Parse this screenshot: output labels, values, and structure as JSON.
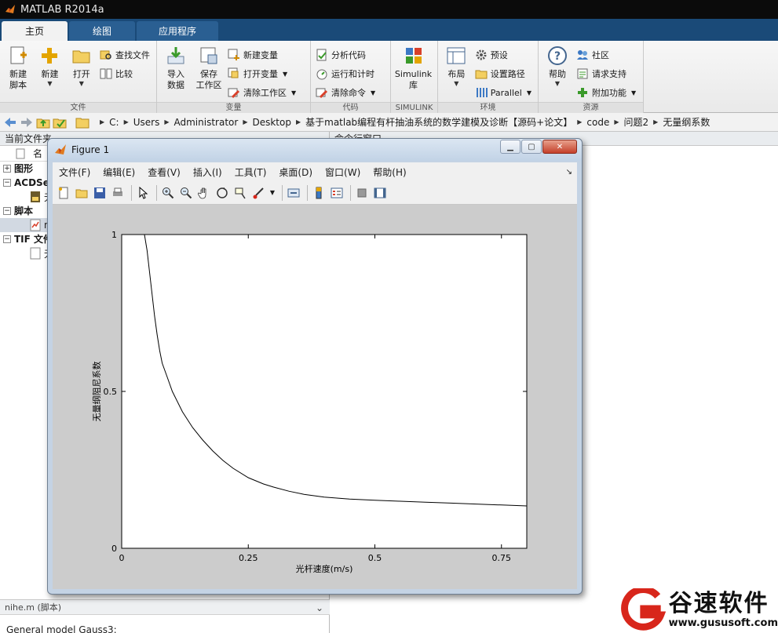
{
  "app": {
    "title": "MATLAB R2014a"
  },
  "tabs": [
    {
      "label": "主页"
    },
    {
      "label": "绘图"
    },
    {
      "label": "应用程序"
    }
  ],
  "ribbon": {
    "file": {
      "label": "文件",
      "new_script": "新建\n脚本",
      "new": "新建",
      "open": "打开",
      "find_files": "查找文件",
      "compare": "比较"
    },
    "variable": {
      "label": "变量",
      "import": "导入\n数据",
      "save_ws": "保存\n工作区",
      "new_var": "新建变量",
      "open_var": "打开变量",
      "clear_ws": "清除工作区"
    },
    "code": {
      "label": "代码",
      "analyze": "分析代码",
      "run_time": "运行和计时",
      "clear_cmd": "清除命令"
    },
    "simulink": {
      "label": "SIMULINK",
      "lib": "Simulink\n库"
    },
    "env": {
      "label": "环境",
      "layout": "布局",
      "prefs": "预设",
      "set_path": "设置路径",
      "parallel": "Parallel"
    },
    "resources": {
      "label": "资源",
      "help": "帮助",
      "community": "社区",
      "support": "请求支持",
      "addons": "附加功能"
    }
  },
  "address": {
    "crumbs": [
      "C:",
      "Users",
      "Administrator",
      "Desktop",
      "基于matlab编程有杆抽油系统的数学建模及诊断【源码+论文】",
      "code",
      "问题2",
      "无量纲系数"
    ]
  },
  "left_panel": {
    "title": "当前文件夹",
    "col_name": "名",
    "groups": [
      {
        "label": "图形",
        "expanded": false
      },
      {
        "label": "ACDSe",
        "expanded": true
      },
      {
        "label": "脚本",
        "expanded": true
      },
      {
        "label": "TIF 文件",
        "expanded": true
      }
    ],
    "leaf_acdsee": "无",
    "leaf_script": "n",
    "leaf_tif": "无",
    "detail_header": "nihe.m (脚本)",
    "detail_text": "General model Gauss3:"
  },
  "right_panel": {
    "title": "命令行窗口"
  },
  "figure": {
    "title": "Figure 1",
    "menus": [
      "文件(F)",
      "编辑(E)",
      "查看(V)",
      "插入(I)",
      "工具(T)",
      "桌面(D)",
      "窗口(W)",
      "帮助(H)"
    ]
  },
  "chart_data": {
    "type": "line",
    "title": "",
    "xlabel": "光杆速度(m/s)",
    "ylabel": "无量纲阻尼系数",
    "xlim": [
      0,
      0.8
    ],
    "ylim": [
      0,
      1
    ],
    "xticks": [
      0,
      0.25,
      0.5,
      0.75
    ],
    "xtick_labels": [
      "0",
      "0.25",
      "0.5",
      "0.75"
    ],
    "yticks": [
      0,
      0.5,
      1
    ],
    "ytick_labels": [
      "0",
      "0.5",
      "1"
    ],
    "grid": false,
    "series": [
      {
        "line_color": "#000000",
        "x": [
          0.045,
          0.05,
          0.055,
          0.06,
          0.065,
          0.07,
          0.075,
          0.08,
          0.09,
          0.1,
          0.12,
          0.14,
          0.16,
          0.18,
          0.2,
          0.22,
          0.25,
          0.28,
          0.3,
          0.33,
          0.36,
          0.4,
          0.45,
          0.5,
          0.55,
          0.6,
          0.65,
          0.7,
          0.75,
          0.8
        ],
        "y": [
          1.0,
          0.95,
          0.88,
          0.81,
          0.74,
          0.68,
          0.63,
          0.59,
          0.545,
          0.5,
          0.435,
          0.385,
          0.345,
          0.31,
          0.28,
          0.255,
          0.225,
          0.205,
          0.195,
          0.182,
          0.172,
          0.163,
          0.157,
          0.153,
          0.15,
          0.147,
          0.144,
          0.141,
          0.138,
          0.135
        ]
      }
    ]
  },
  "watermark": {
    "title": "谷速软件",
    "url": "www.gususoft.com"
  },
  "colors": {
    "accent": "#1a4a78",
    "tab_inactive": "#2a5f92",
    "watermark_red": "#d8261b"
  }
}
